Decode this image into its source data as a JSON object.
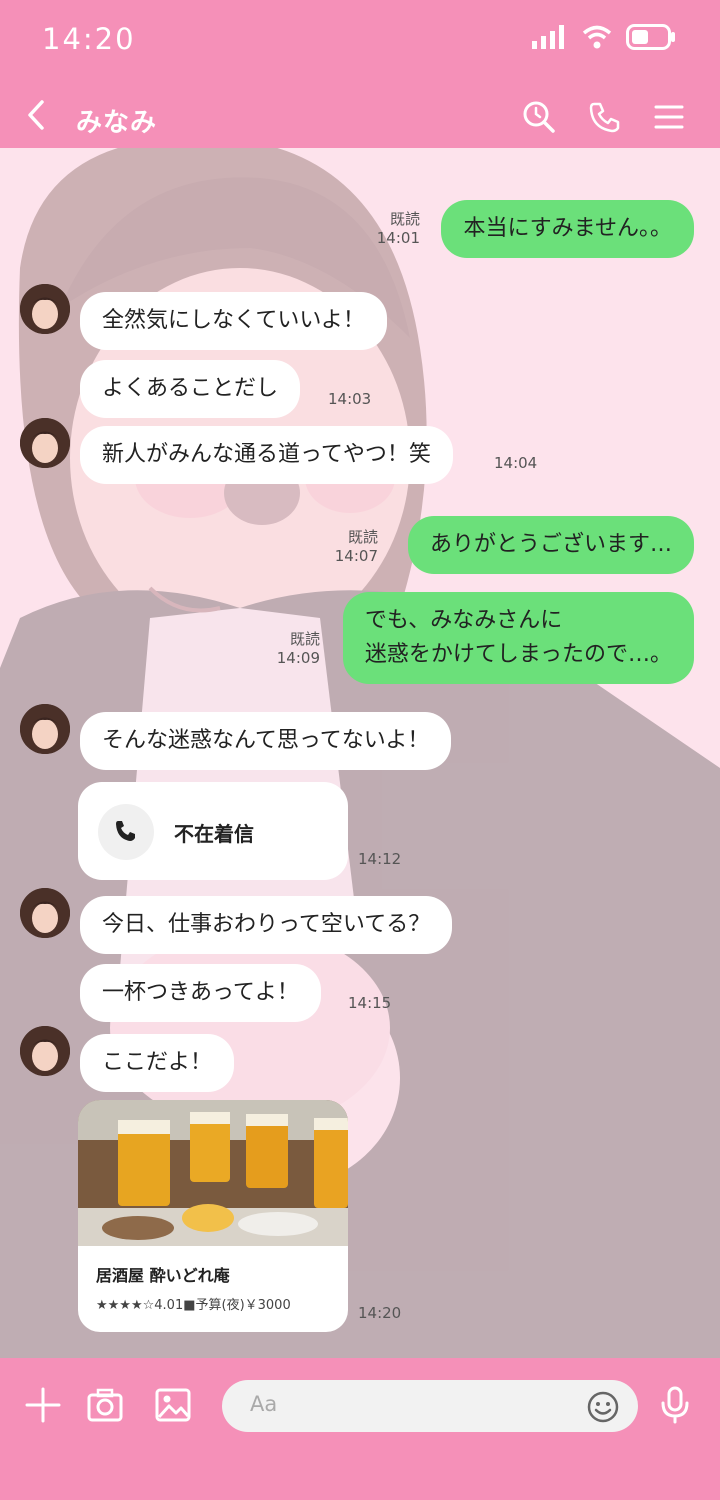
{
  "status": {
    "time": "14:20"
  },
  "header": {
    "contact_name": "みなみ"
  },
  "messages": [
    {
      "text": "本当にすみません。。",
      "read": "既読",
      "time": "14:01"
    },
    {
      "text": "全然気にしなくていいよ！"
    },
    {
      "text": "よくあることだし",
      "time": "14:03"
    },
    {
      "text": "新人がみんな通る道ってやつ！笑",
      "time": "14:04"
    },
    {
      "text": "ありがとうございます…",
      "read": "既読",
      "time": "14:07"
    },
    {
      "line1": "でも、みなみさんに",
      "line2": "迷惑をかけてしまったので…。",
      "read": "既読",
      "time": "14:09"
    },
    {
      "text": "そんな迷惑なんて思ってないよ！"
    },
    {
      "text": "不在着信",
      "time": "14:12"
    },
    {
      "text": "今日、仕事おわりって空いてる？"
    },
    {
      "text": "一杯つきあってよ！",
      "time": "14:15"
    },
    {
      "text": "ここだよ！"
    },
    {
      "shop_name": "居酒屋 酔いどれ庵",
      "shop_info": "★★★★☆4.01■予算(夜)￥3000",
      "time": "14:20"
    }
  ],
  "input": {
    "placeholder": "Aa"
  },
  "colors": {
    "bar": "#f590b8",
    "chat_bg": "#fde3ec",
    "out_bubble": "#6be07a",
    "in_bubble": "#ffffff"
  },
  "icons": [
    "back-icon",
    "search-icon",
    "phone-icon",
    "menu-icon",
    "plus-icon",
    "camera-icon",
    "image-icon",
    "emoji-icon",
    "mic-icon",
    "missed-call-icon"
  ]
}
